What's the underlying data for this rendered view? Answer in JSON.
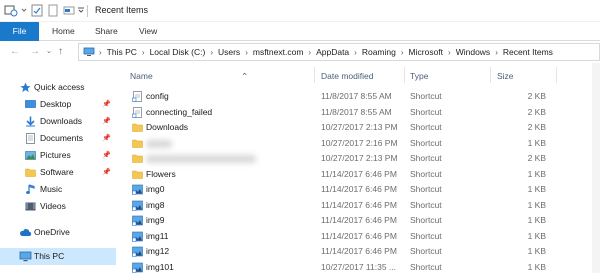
{
  "window": {
    "title": "Recent Items"
  },
  "quick_access_toolbar": {
    "icons": [
      "properties-icon",
      "checkmark-icon",
      "blank-page-icon",
      "rename-icon",
      "customize-toolbar-icon"
    ]
  },
  "ribbon": {
    "tabs": [
      {
        "label": "File"
      },
      {
        "label": "Home"
      },
      {
        "label": "Share"
      },
      {
        "label": "View"
      }
    ]
  },
  "address": {
    "crumbs": [
      "This PC",
      "Local Disk (C:)",
      "Users",
      "msftnext.com",
      "AppData",
      "Roaming",
      "Microsoft",
      "Windows",
      "Recent Items"
    ]
  },
  "nav": {
    "items": [
      {
        "label": "Quick access",
        "icon": "star-icon",
        "pinned": false
      },
      {
        "label": "Desktop",
        "icon": "desktop-icon",
        "pinned": true
      },
      {
        "label": "Downloads",
        "icon": "download-arrow-icon",
        "pinned": true
      },
      {
        "label": "Documents",
        "icon": "documents-icon",
        "pinned": true
      },
      {
        "label": "Pictures",
        "icon": "pictures-icon",
        "pinned": true
      },
      {
        "label": "Software",
        "icon": "folder-icon",
        "pinned": true
      },
      {
        "label": "Music",
        "icon": "music-note-icon",
        "pinned": false
      },
      {
        "label": "Videos",
        "icon": "videos-icon",
        "pinned": false
      },
      {
        "label": "OneDrive",
        "icon": "cloud-icon",
        "pinned": false
      },
      {
        "label": "This PC",
        "icon": "computer-icon",
        "pinned": false
      }
    ]
  },
  "columns": {
    "name": "Name",
    "date": "Date modified",
    "type": "Type",
    "size": "Size"
  },
  "files": [
    {
      "name": "config",
      "date": "11/8/2017 8:55 AM",
      "type": "Shortcut",
      "size": "2 KB",
      "icon": "shortcut-icon"
    },
    {
      "name": "connecting_failed",
      "date": "11/8/2017 8:55 AM",
      "type": "Shortcut",
      "size": "2 KB",
      "icon": "shortcut-icon"
    },
    {
      "name": "Downloads",
      "date": "10/27/2017 2:13 PM",
      "type": "Shortcut",
      "size": "2 KB",
      "icon": "folder-icon"
    },
    {
      "name": "",
      "date": "10/27/2017 2:16 PM",
      "type": "Shortcut",
      "size": "1 KB",
      "icon": "folder-icon",
      "blurred": true
    },
    {
      "name": "",
      "date": "10/27/2017 2:13 PM",
      "type": "Shortcut",
      "size": "2 KB",
      "icon": "folder-icon",
      "blurred": true
    },
    {
      "name": "Flowers",
      "date": "11/14/2017 6:46 PM",
      "type": "Shortcut",
      "size": "1 KB",
      "icon": "folder-icon"
    },
    {
      "name": "img0",
      "date": "11/14/2017 6:46 PM",
      "type": "Shortcut",
      "size": "1 KB",
      "icon": "image-shortcut-icon"
    },
    {
      "name": "img8",
      "date": "11/14/2017 6:46 PM",
      "type": "Shortcut",
      "size": "1 KB",
      "icon": "image-shortcut-icon"
    },
    {
      "name": "img9",
      "date": "11/14/2017 6:46 PM",
      "type": "Shortcut",
      "size": "1 KB",
      "icon": "image-shortcut-icon"
    },
    {
      "name": "img11",
      "date": "11/14/2017 6:46 PM",
      "type": "Shortcut",
      "size": "1 KB",
      "icon": "image-shortcut-icon"
    },
    {
      "name": "img12",
      "date": "11/14/2017 6:46 PM",
      "type": "Shortcut",
      "size": "1 KB",
      "icon": "image-shortcut-icon"
    },
    {
      "name": "img101",
      "date": "10/27/2017 11:35 ...",
      "type": "Shortcut",
      "size": "1 KB",
      "icon": "image-shortcut-icon"
    }
  ],
  "colors": {
    "accent": "#1979ca",
    "selected": "#cce8ff",
    "folder": "#f4c653",
    "header_text": "#4c607a"
  }
}
